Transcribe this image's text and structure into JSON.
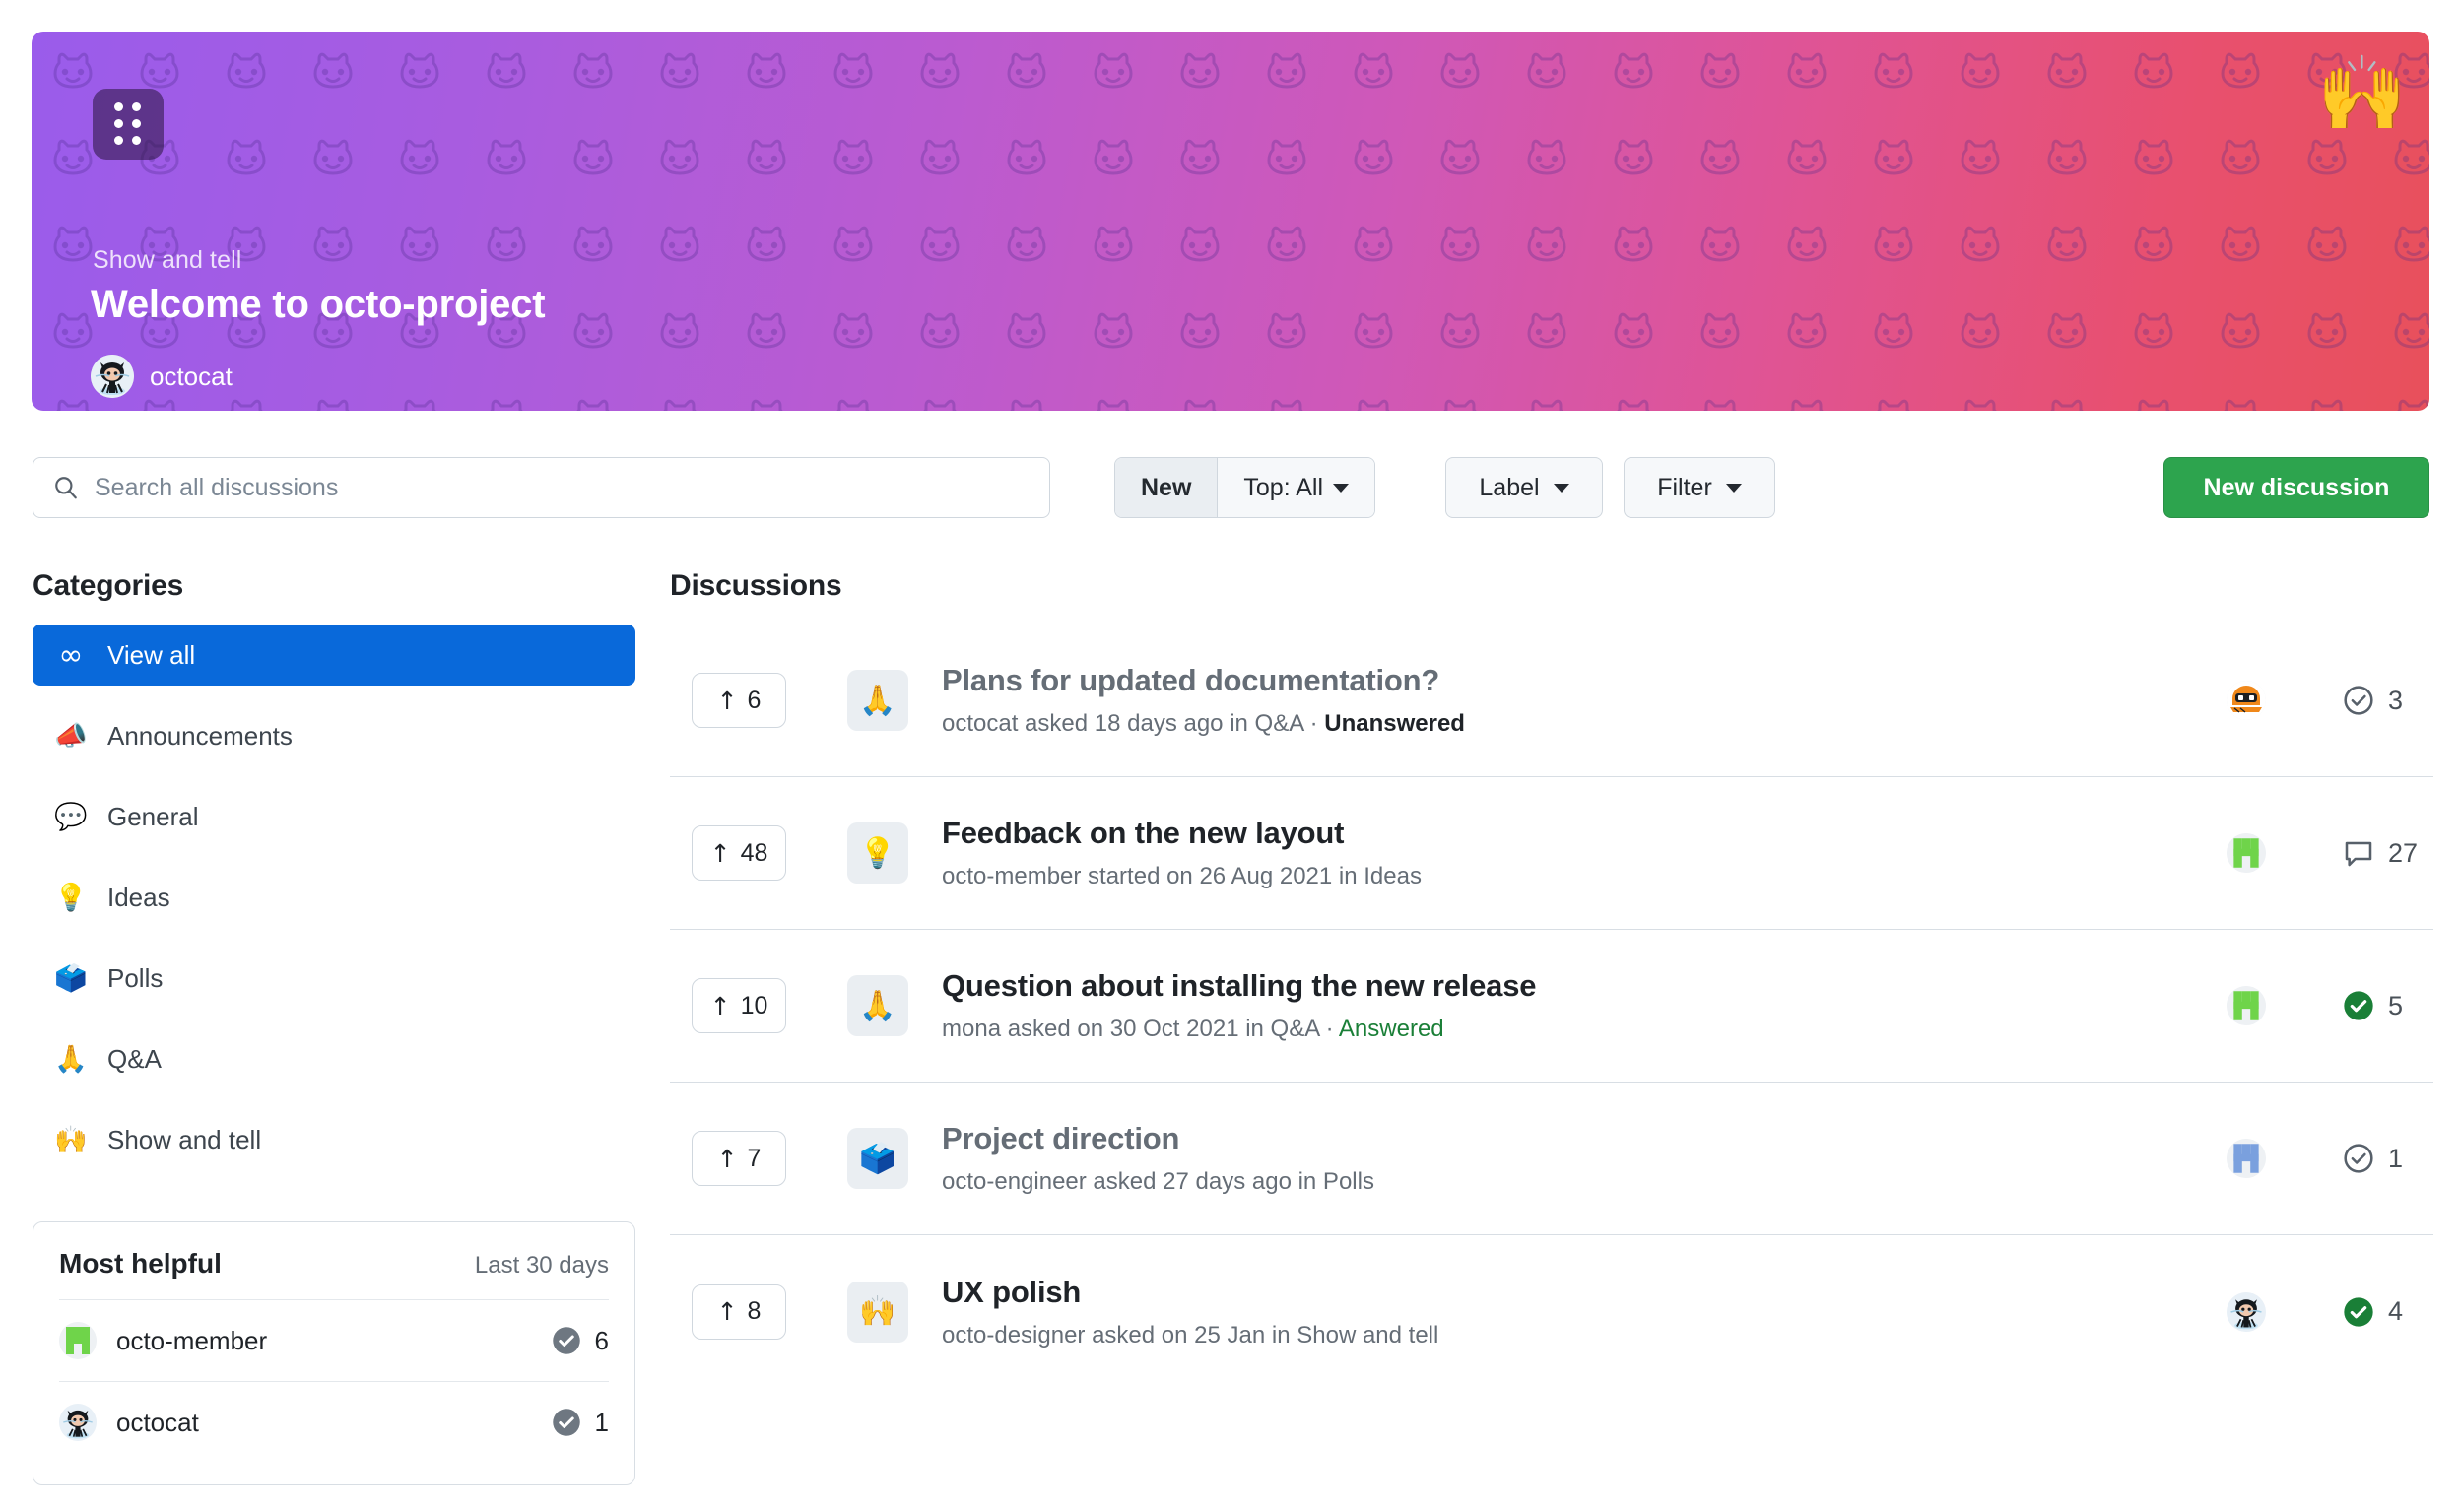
{
  "hero": {
    "logo_icon": "grid-dots-icon",
    "hands_emoji": "🙌",
    "category_label": "Show and tell",
    "title": "Welcome to octo-project",
    "author": "octocat",
    "gradient_from": "#9a5ceb",
    "gradient_to": "#e8505b"
  },
  "toolbar": {
    "search_placeholder": "Search all discussions",
    "search_value": "",
    "sort_new": "New",
    "sort_top": "Top: All",
    "label_button": "Label",
    "filter_button": "Filter",
    "new_discussion": "New discussion",
    "primary_color": "#2da44e"
  },
  "sidebar": {
    "heading": "Categories",
    "active_color": "#0969da",
    "items": [
      {
        "emoji": "∞",
        "label": "View all",
        "active": true
      },
      {
        "emoji": "📣",
        "label": "Announcements",
        "active": false
      },
      {
        "emoji": "💬",
        "label": "General",
        "active": false
      },
      {
        "emoji": "💡",
        "label": "Ideas",
        "active": false
      },
      {
        "emoji": "🗳️",
        "label": "Polls",
        "active": false
      },
      {
        "emoji": "🙏",
        "label": "Q&A",
        "active": false
      },
      {
        "emoji": "🙌",
        "label": "Show and tell",
        "active": false
      }
    ],
    "most_helpful": {
      "title": "Most helpful",
      "period": "Last 30 days",
      "people": [
        {
          "name": "octo-member",
          "count": "6",
          "avatar": "octo-member-avatar"
        },
        {
          "name": "octocat",
          "count": "1",
          "avatar": "octocat-avatar"
        }
      ]
    }
  },
  "main": {
    "heading": "Discussions",
    "rows": [
      {
        "upvotes": "6",
        "emoji": "🙏",
        "title": "Plans for updated documentation?",
        "visited": true,
        "meta_prefix": "octocat asked 18 days ago in Q&A · ",
        "status": "Unanswered",
        "status_kind": "unanswered",
        "avatar": "hubot-avatar",
        "count": "3",
        "count_icon": "check-circle-outline-icon"
      },
      {
        "upvotes": "48",
        "emoji": "💡",
        "title": "Feedback on the new layout",
        "visited": false,
        "meta_prefix": "octo-member started on 26 Aug 2021 in Ideas",
        "status": "",
        "status_kind": "none",
        "avatar": "octo-member-avatar",
        "count": "27",
        "count_icon": "comment-icon"
      },
      {
        "upvotes": "10",
        "emoji": "🙏",
        "title": "Question about installing the new release",
        "visited": false,
        "meta_prefix": "mona asked on 30 Oct 2021 in Q&A · ",
        "status": "Answered",
        "status_kind": "answered",
        "avatar": "octo-member-avatar",
        "count": "5",
        "count_icon": "check-circle-filled-icon"
      },
      {
        "upvotes": "7",
        "emoji": "🗳️",
        "title": "Project direction",
        "visited": true,
        "meta_prefix": "octo-engineer asked 27 days ago in Polls",
        "status": "",
        "status_kind": "none",
        "avatar": "octo-engineer-avatar",
        "count": "1",
        "count_icon": "check-circle-outline-icon"
      },
      {
        "upvotes": "8",
        "emoji": "🙌",
        "title": "UX polish",
        "visited": false,
        "meta_prefix": "octo-designer asked on 25 Jan in Show and tell",
        "status": "",
        "status_kind": "none",
        "avatar": "octocat-avatar",
        "count": "4",
        "count_icon": "check-circle-filled-icon"
      }
    ]
  }
}
